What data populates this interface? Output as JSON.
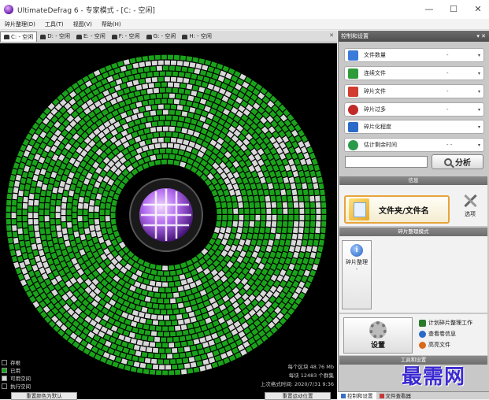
{
  "window": {
    "title": "UltimateDefrag 6 - 专家模式 - [C: - 空闲]",
    "controls": {
      "minimize": "—",
      "maximize": "☐",
      "close": "✕"
    }
  },
  "menu": [
    "碎片整理(D)",
    "工具(T)",
    "视图(V)",
    "帮助(H)"
  ],
  "drive_tabs": [
    {
      "label": "C: - 空闲",
      "active": true
    },
    {
      "label": "D: - 空闲",
      "active": false
    },
    {
      "label": "E: - 空闲",
      "active": false
    },
    {
      "label": "F: - 空闲",
      "active": false
    },
    {
      "label": "G: - 空闲",
      "active": false
    },
    {
      "label": "H: - 空闲",
      "active": false
    }
  ],
  "tab_close": "✕",
  "legend": [
    {
      "label": "存根",
      "color": "#000000"
    },
    {
      "label": "已用",
      "color": "#1aa31a"
    },
    {
      "label": "可用空间",
      "color": "#d8d8d8"
    },
    {
      "label": "执行空间",
      "color": "#000000"
    }
  ],
  "stats": {
    "per_block": "每个区块 48.76 Mb",
    "files_per_block": "每块 12483 个群集",
    "last_defrag": "上次格式时间: 2020/7/31 9:36"
  },
  "map_buttons": {
    "reset_colors": "重置颜色为默认",
    "reset_position": "重置运动位置"
  },
  "panel": {
    "title": "控制和设置",
    "pin": "▾ ✕",
    "options": [
      {
        "label": "文件数量",
        "value": "-",
        "icon_color": "#3b7ad8"
      },
      {
        "label": "连续文件",
        "value": "-",
        "icon_color": "#2f9b3a"
      },
      {
        "label": "碎片文件",
        "value": "-",
        "icon_color": "#d23b2f"
      },
      {
        "label": "碎片过多",
        "value": "-",
        "icon_color": "#c22a2a"
      },
      {
        "label": "碎片化程度",
        "value": "",
        "icon_color": "#2a6ac8"
      },
      {
        "label": "估计剩余时间",
        "value": "- -",
        "icon_color": "#2a9a4a"
      }
    ],
    "search_value": "",
    "analyze_label": "分析",
    "info_section": "信息",
    "folder_file_label": "文件夹/文件名",
    "select_label": "选项",
    "mode_section": "碎片整理模式",
    "mode_button_label": "碎片整理",
    "mode_button_sub": "-",
    "settings_label": "设置",
    "links": [
      {
        "label": "计划碎片整理工作",
        "icon_color": "#2a7a2a"
      },
      {
        "label": "查看卷信息",
        "icon_color": "#2a6ac8"
      },
      {
        "label": "高亮文件",
        "icon_color": "#d86a1a"
      }
    ],
    "toolbox_section": "工具和设置"
  },
  "dock_tabs": [
    {
      "label": "控制和设置",
      "active": true
    },
    {
      "label": "文件查看器",
      "active": false
    }
  ],
  "watermark": "最需网"
}
